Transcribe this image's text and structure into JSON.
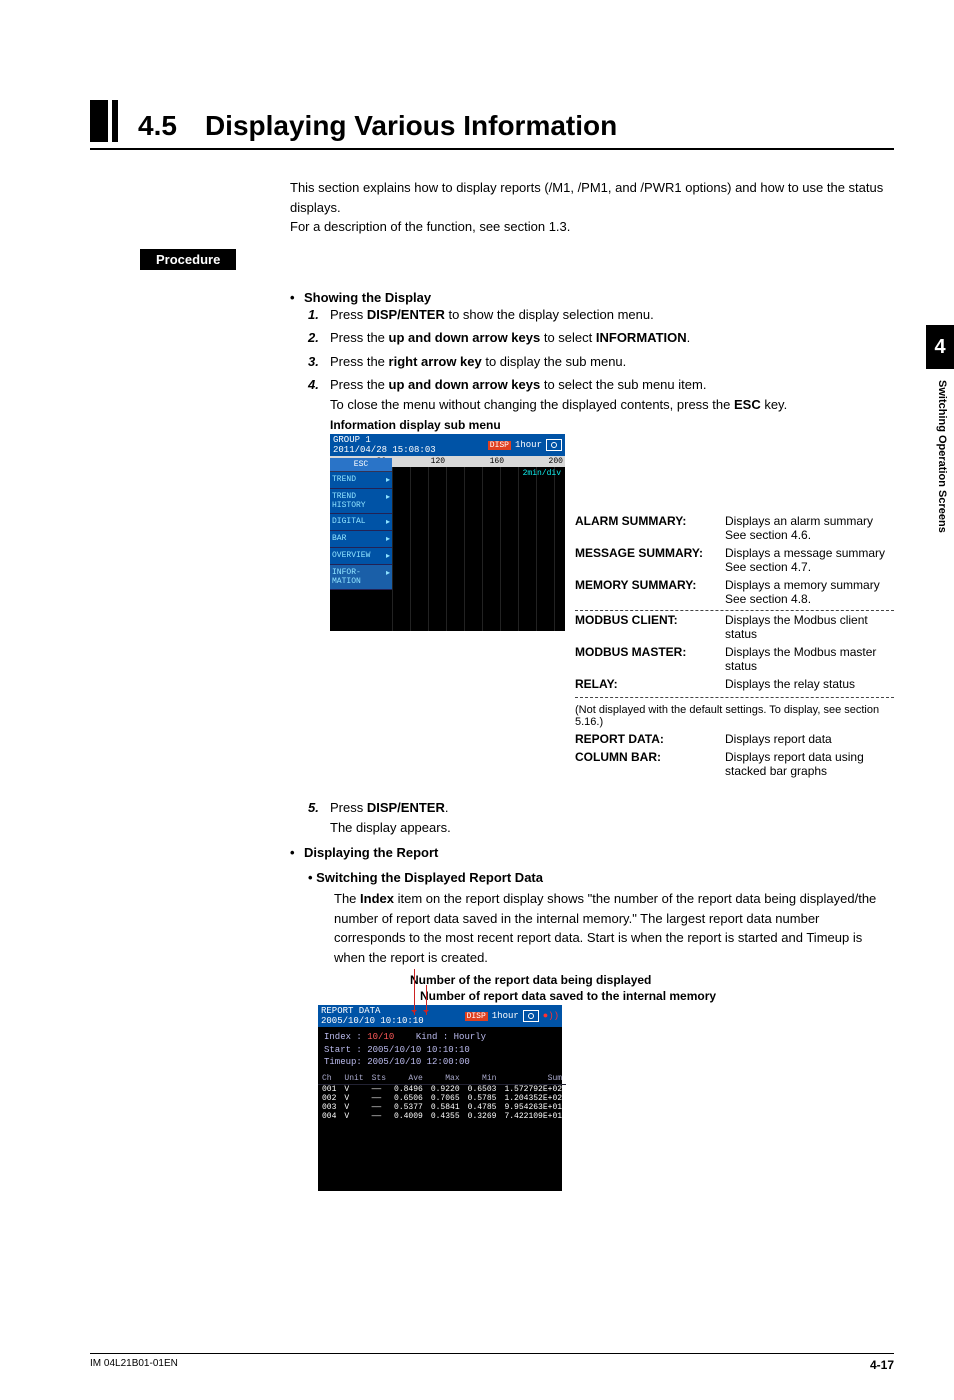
{
  "chapter_tab": "4",
  "side_label": "Switching Operation Screens",
  "title_num": "4.5",
  "title_text": "Displaying Various Information",
  "intro_p1": "This section explains how to display reports (/M1, /PM1, and /PWR1 options) and how to use the status displays.",
  "intro_p2": "For a description of the function, see section 1.3.",
  "procedure_label": "Procedure",
  "showing_heading": "Showing the Display",
  "steps": {
    "s1_a": "Press ",
    "s1_b": "DISP/ENTER",
    "s1_c": " to show the display selection menu.",
    "s2_a": "Press the ",
    "s2_b": "up and down arrow keys",
    "s2_c": " to select ",
    "s2_d": "INFORMATION",
    "s2_e": ".",
    "s3_a": "Press the ",
    "s3_b": "right arrow key",
    "s3_c": " to display the sub menu.",
    "s4_a": "Press the ",
    "s4_b": "up and down arrow keys",
    "s4_c": " to select the sub menu item.",
    "s4_note_a": "To close the menu without changing the displayed contents, press the ",
    "s4_note_b": "ESC",
    "s4_note_c": " key."
  },
  "caption1": "Information display sub menu",
  "trend": {
    "group": "GROUP 1",
    "datetime": "2011/04/28 15:08:03",
    "disp": "DISP",
    "interval": "1hour",
    "scale": [
      "80",
      "120",
      "160",
      "200"
    ],
    "divlabel": "2min/div",
    "menu": {
      "esc": "ESC",
      "items": [
        "TREND",
        "TREND HISTORY",
        "DIGITAL",
        "BAR",
        "OVERVIEW",
        "INFOR-MATION"
      ]
    },
    "submenu": [
      "ALARM SUMMARY",
      "MESSAGE SUMMAR",
      "MEMORY SUMMARY",
      "MODBUS CLIENT",
      "RELAY",
      "REPORT DATA",
      "COLUMN BAR"
    ]
  },
  "desc": {
    "alarm": {
      "lbl": "ALARM SUMMARY:",
      "txt": "Displays an alarm summary See section 4.6."
    },
    "message": {
      "lbl": "MESSAGE SUMMARY:",
      "txt": "Displays a message summary See section 4.7."
    },
    "memory": {
      "lbl": "MEMORY SUMMARY:",
      "txt": "Displays a memory summary See section 4.8."
    },
    "modbusc": {
      "lbl": "MODBUS CLIENT:",
      "txt": "Displays the Modbus client status"
    },
    "modbusm": {
      "lbl": "MODBUS MASTER:",
      "txt": "Displays the Modbus master status"
    },
    "relay": {
      "lbl": "RELAY:",
      "txt": "Displays the relay status"
    },
    "dash_note": "(Not displayed with the default settings. To display, see section 5.16.)",
    "report": {
      "lbl": "REPORT DATA:",
      "txt": "Displays report data"
    },
    "column": {
      "lbl": "COLUMN BAR:",
      "txt": "Displays report data using stacked bar graphs"
    }
  },
  "step5_a": "Press ",
  "step5_b": "DISP/ENTER",
  "step5_c": ".",
  "step5_sub": "The display appears.",
  "disp_report_h": "Displaying the Report",
  "switching_h": "Switching the Displayed Report Data",
  "switching_p_a": "The ",
  "switching_p_b": "Index",
  "switching_p_c": " item on the report display shows \"the number of the report data being displayed/the number of report data saved in the internal memory.\" The largest report data number corresponds to the most recent report data. Start is when the report is started and Timeup is when the report is created.",
  "fig2_c1": "Number of the report data being displayed",
  "fig2_c2": "Number of report data saved to the internal memory",
  "report": {
    "title": "REPORT DATA",
    "datetime": "2005/10/10 10:10:10",
    "disp": "DISP",
    "interval": "1hour",
    "index_lbl": "Index :",
    "index_val": "10/10",
    "kind_lbl": "Kind :",
    "kind_val": "Hourly",
    "start_lbl": "Start :",
    "start_val": "2005/10/10 10:10:10",
    "timeup_lbl": "Timeup:",
    "timeup_val": "2005/10/10 12:00:00",
    "cols": [
      "Ch",
      "Unit",
      "Sts",
      "Ave",
      "Max",
      "Min",
      "Sum"
    ],
    "rows": [
      {
        "ch": "001",
        "unit": "V",
        "sts": "——",
        "ave": "0.8496",
        "max": "0.9220",
        "min": "0.6503",
        "sum": "1.572792E+02"
      },
      {
        "ch": "002",
        "unit": "V",
        "sts": "——",
        "ave": "0.6506",
        "max": "0.7065",
        "min": "0.5785",
        "sum": "1.204352E+02"
      },
      {
        "ch": "003",
        "unit": "V",
        "sts": "——",
        "ave": "0.5377",
        "max": "0.5841",
        "min": "0.4785",
        "sum": "9.954263E+01"
      },
      {
        "ch": "004",
        "unit": "V",
        "sts": "——",
        "ave": "0.4009",
        "max": "0.4355",
        "min": "0.3269",
        "sum": "7.422109E+01"
      }
    ]
  },
  "footer_left": "IM 04L21B01-01EN",
  "footer_right": "4-17"
}
